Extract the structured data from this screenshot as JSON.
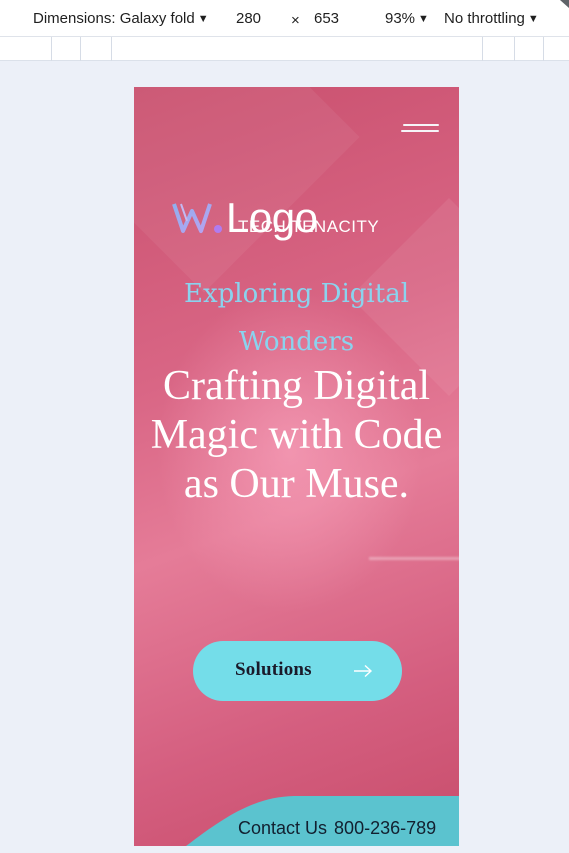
{
  "devtools": {
    "dimensions_label": "Dimensions: Galaxy fold",
    "width": "280",
    "times": "×",
    "height": "653",
    "zoom": "93%",
    "throttling": "No throttling",
    "caret": "▼"
  },
  "site": {
    "logo_text": "Logo",
    "logo_sub": "TECH TENACITY",
    "eyebrow": "Exploring Digital Wonders",
    "headline": "Crafting Digital Magic with Code as Our Muse.",
    "cta_label": "Solutions",
    "contact_label": "Contact Us",
    "phone": "800-236-789",
    "colors": {
      "background": "#d96685",
      "eyebrow": "#8ad3ee",
      "cta": "#74dde9",
      "footer": "#5bc3cf"
    }
  }
}
